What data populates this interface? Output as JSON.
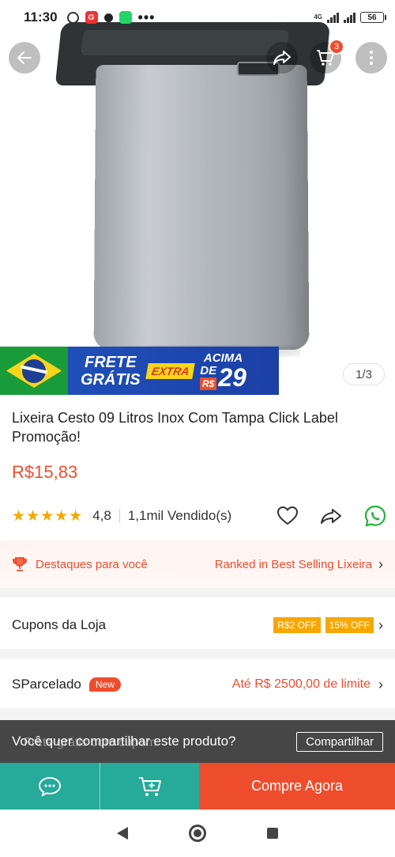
{
  "status_bar": {
    "time": "11:30",
    "network": "4G",
    "battery": "56"
  },
  "header": {
    "cart_count": "3"
  },
  "banner": {
    "frete_line1": "FRETE",
    "frete_line2": "GRÁTIS",
    "extra": "EXTRA",
    "acima": "ACIMA",
    "de": "DE",
    "currency": "R$",
    "threshold": "29"
  },
  "gallery": {
    "counter": "1/3"
  },
  "product": {
    "title": "Lixeira Cesto 09 Litros Inox Com Tampa Click Label Promoção!",
    "price": "R$15,83",
    "rating": "4,8",
    "rating_value": 4.8,
    "stars": "★★★★★",
    "sold": "1,1mil Vendido(s)"
  },
  "highlights": {
    "label": "Destaques para você",
    "ranked": "Ranked in Best Selling Lixeira"
  },
  "coupons_row": {
    "label": "Cupons da Loja",
    "coupon1": "R$2 OFF",
    "coupon2": "15% OFF"
  },
  "sparcelado_row": {
    "label": "SParcelado",
    "badge": "New",
    "limit": "Até R$ 2500,00 de limite"
  },
  "share_prompt": {
    "text": "Você quer compartilhar este produto?",
    "button": "Compartilhar",
    "underlying_text": "Frete grátis com cupom"
  },
  "bottom_bar": {
    "buy_label": "Compre Agora"
  },
  "colors": {
    "accent": "#ee4d2d",
    "teal": "#26aa99",
    "star": "#f6a700"
  }
}
